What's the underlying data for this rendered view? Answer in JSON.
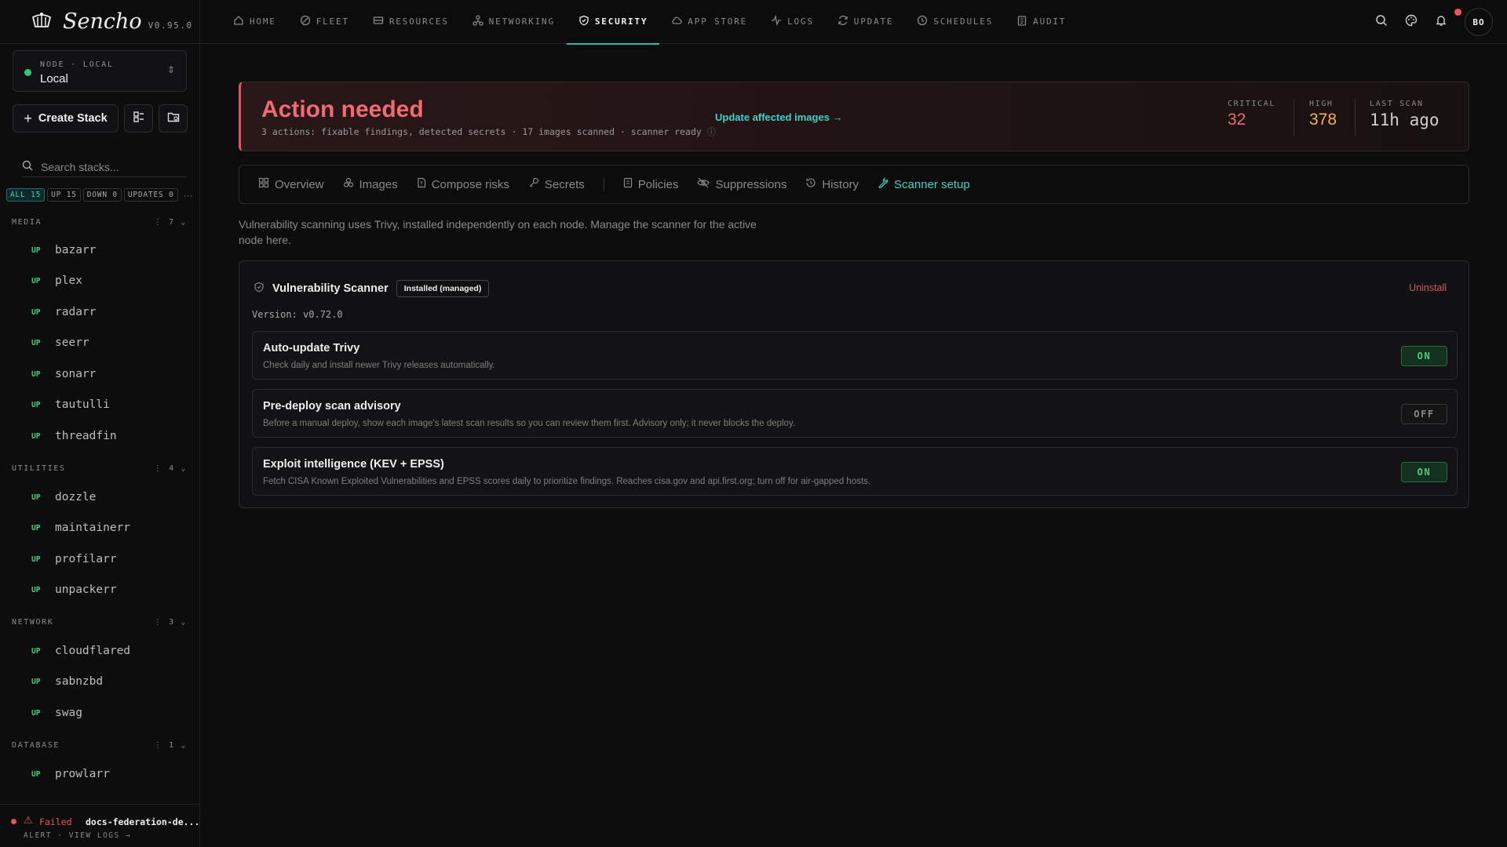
{
  "app": {
    "name": "Sencho",
    "version": "V0.95.0"
  },
  "node": {
    "label": "NODE · LOCAL",
    "value": "Local"
  },
  "sidebar": {
    "create_label": "Create Stack",
    "search_placeholder": "Search stacks...",
    "filters": [
      {
        "label": "ALL",
        "count": "15"
      },
      {
        "label": "UP",
        "count": "15"
      },
      {
        "label": "DOWN",
        "count": "0"
      },
      {
        "label": "UPDATES",
        "count": "0"
      }
    ],
    "groups": [
      {
        "name": "MEDIA",
        "count": "7",
        "items": [
          "bazarr",
          "plex",
          "radarr",
          "seerr",
          "sonarr",
          "tautulli",
          "threadfin"
        ]
      },
      {
        "name": "UTILITIES",
        "count": "4",
        "items": [
          "dozzle",
          "maintainerr",
          "profilarr",
          "unpackerr"
        ]
      },
      {
        "name": "NETWORK",
        "count": "3",
        "items": [
          "cloudflared",
          "sabnzbd",
          "swag"
        ]
      },
      {
        "name": "DATABASE",
        "count": "1",
        "items": [
          "prowlarr"
        ]
      }
    ],
    "status_up": "UP",
    "footer": {
      "status": "Failed",
      "name": "docs-federation-de...",
      "links": "ALERT · VIEW LOGS →"
    }
  },
  "nav": {
    "items": [
      {
        "label": "HOME",
        "icon": "home-icon"
      },
      {
        "label": "FLEET",
        "icon": "fleet-icon"
      },
      {
        "label": "RESOURCES",
        "icon": "resources-icon"
      },
      {
        "label": "NETWORKING",
        "icon": "networking-icon"
      },
      {
        "label": "SECURITY",
        "icon": "shield-icon"
      },
      {
        "label": "APP STORE",
        "icon": "cloud-icon"
      },
      {
        "label": "LOGS",
        "icon": "activity-icon"
      },
      {
        "label": "UPDATE",
        "icon": "refresh-icon"
      },
      {
        "label": "SCHEDULES",
        "icon": "clock-icon"
      },
      {
        "label": "AUDIT",
        "icon": "clipboard-icon"
      }
    ],
    "active": "SECURITY",
    "avatar": "BO"
  },
  "banner": {
    "title": "Action needed",
    "subtitle": "3 actions: fixable findings, detected secrets · 17 images scanned · scanner ready",
    "link": "Update affected images →",
    "critical_label": "CRITICAL",
    "critical": "32",
    "high_label": "HIGH",
    "high": "378",
    "scan_label": "LAST SCAN",
    "scan": "11h ago",
    "colors": {
      "critical": "#f16a70",
      "high": "#f5b442"
    }
  },
  "tabs": [
    {
      "label": "Overview",
      "icon": "grid-icon"
    },
    {
      "label": "Images",
      "icon": "layers-icon"
    },
    {
      "label": "Compose risks",
      "icon": "file-icon"
    },
    {
      "label": "Secrets",
      "icon": "key-icon"
    },
    {
      "label": "Policies",
      "icon": "document-icon"
    },
    {
      "label": "Suppressions",
      "icon": "eye-off-icon"
    },
    {
      "label": "History",
      "icon": "history-icon"
    },
    {
      "label": "Scanner setup",
      "icon": "wrench-icon"
    }
  ],
  "description": "Vulnerability scanning uses Trivy, installed independently on each node. Manage the scanner for the active node here.",
  "scanner": {
    "title": "Vulnerability Scanner",
    "badge": "Installed (managed)",
    "uninstall": "Uninstall",
    "version": "Version: v0.72.0",
    "options": [
      {
        "title": "Auto-update Trivy",
        "desc": "Check daily and install newer Trivy releases automatically.",
        "state": "ON"
      },
      {
        "title": "Pre-deploy scan advisory",
        "desc": "Before a manual deploy, show each image's latest scan results so you can review them first. Advisory only; it never blocks the deploy.",
        "state": "OFF"
      },
      {
        "title": "Exploit intelligence (KEV + EPSS)",
        "desc": "Fetch CISA Known Exploited Vulnerabilities and EPSS scores daily to prioritize findings. Reaches cisa.gov and api.first.org; turn off for air-gapped hosts.",
        "state": "ON"
      }
    ]
  }
}
